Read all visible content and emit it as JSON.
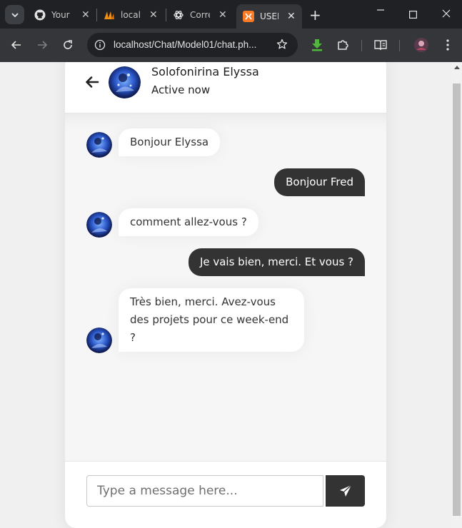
{
  "browser": {
    "tabs": [
      {
        "title": "Your",
        "icon": "github-icon"
      },
      {
        "title": "local",
        "icon": "phpmyadmin-icon"
      },
      {
        "title": "Corre",
        "icon": "chatgpt-icon"
      },
      {
        "title": "USER",
        "icon": "xampp-icon",
        "active": true
      }
    ],
    "url": "localhost/Chat/Model01/chat.ph..."
  },
  "chat": {
    "header": {
      "name": "Solofonirina Elyssa",
      "status": "Active now"
    },
    "messages": [
      {
        "direction": "incoming",
        "text": "Bonjour Elyssa"
      },
      {
        "direction": "outgoing",
        "text": "Bonjour Fred"
      },
      {
        "direction": "incoming",
        "text": "comment allez-vous ?"
      },
      {
        "direction": "outgoing",
        "text": "Je vais bien, merci. Et vous ?"
      },
      {
        "direction": "incoming",
        "text": "Très bien, merci. Avez-vous des projets pour ce week-end ?"
      }
    ],
    "input_placeholder": "Type a message here..."
  },
  "colors": {
    "accent": "#333333",
    "chat_bg": "#f6f6f6",
    "chrome_dark": "#202124"
  }
}
